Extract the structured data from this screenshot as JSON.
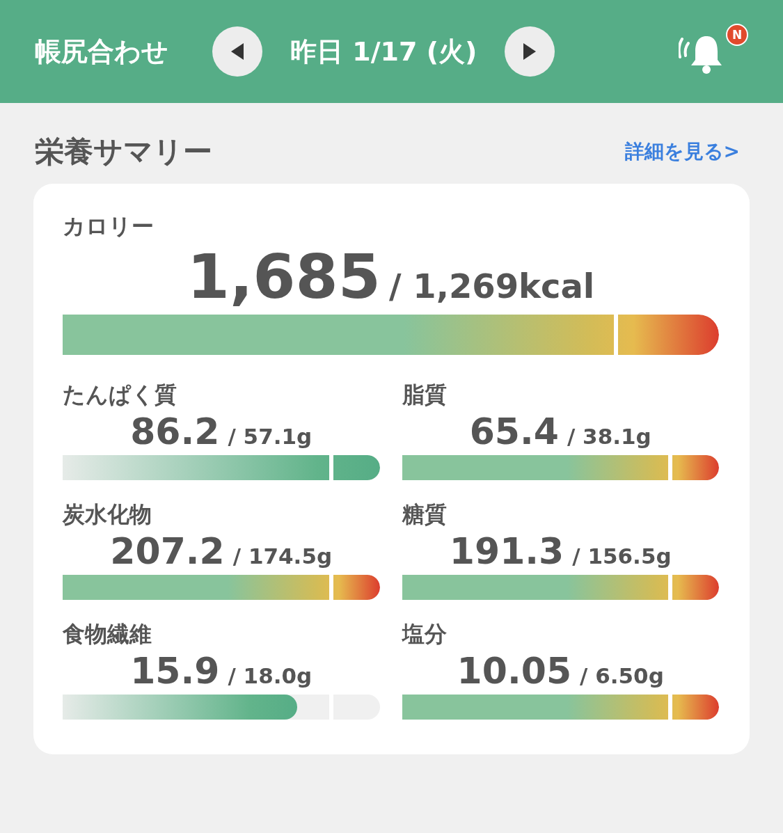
{
  "header": {
    "title": "帳尻合わせ",
    "date": "昨日 1/17 (火)",
    "badge": "N"
  },
  "section": {
    "title": "栄養サマリー",
    "link": "詳細を見る>"
  },
  "calorie": {
    "label": "カロリー",
    "value": "1,685",
    "target": "/ 1,269kcal",
    "level": 1,
    "kind": "heat"
  },
  "nutrients": [
    {
      "label": "たんぱく質",
      "value": "86.2",
      "target": "/ 57.1g",
      "level": 1,
      "kind": "rise"
    },
    {
      "label": "脂質",
      "value": "65.4",
      "target": "/ 38.1g",
      "level": 1,
      "kind": "heat"
    },
    {
      "label": "炭水化物",
      "value": "207.2",
      "target": "/ 174.5g",
      "level": 1,
      "kind": "heat"
    },
    {
      "label": "糖質",
      "value": "191.3",
      "target": "/ 156.5g",
      "level": 1,
      "kind": "heat"
    },
    {
      "label": "食物繊維",
      "value": "15.9",
      "target": "/ 18.0g",
      "level": 0.74,
      "kind": "rise"
    },
    {
      "label": "塩分",
      "value": "10.05",
      "target": "/ 6.50g",
      "level": 1,
      "kind": "heat"
    }
  ]
}
